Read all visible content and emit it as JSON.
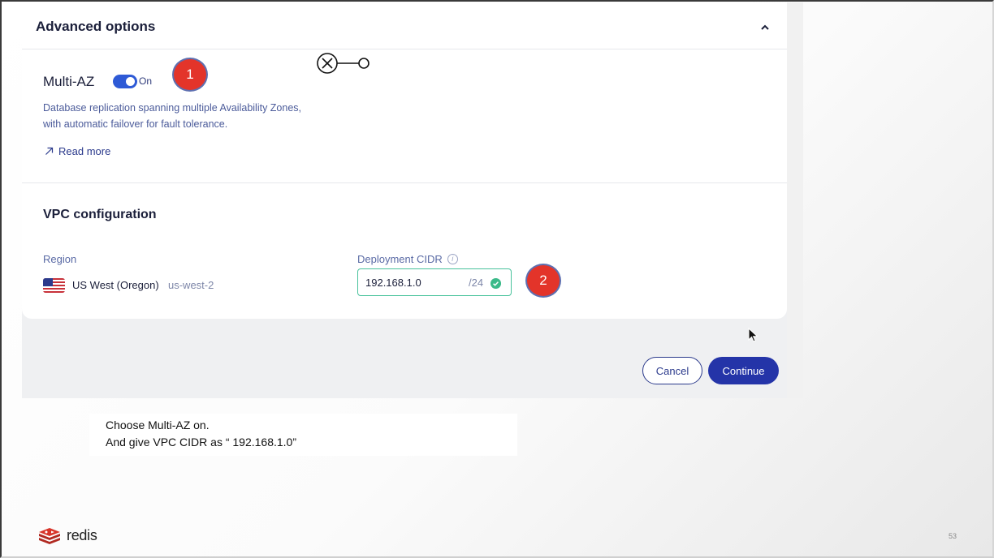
{
  "advanced": {
    "title": "Advanced options",
    "multi_az": {
      "label": "Multi-AZ",
      "toggle_on": true,
      "state_text": "On",
      "description_line1": "Database replication spanning multiple Availability Zones,",
      "description_line2": "with automatic failover for fault tolerance.",
      "read_more": "Read more"
    }
  },
  "vpc": {
    "title": "VPC configuration",
    "region_label": "Region",
    "region_name": "US West (Oregon)",
    "region_code": "us-west-2",
    "cidr_label": "Deployment CIDR",
    "cidr_value": "192.168.1.0",
    "cidr_suffix": "/24"
  },
  "buttons": {
    "cancel": "Cancel",
    "continue": "Continue"
  },
  "annotations": {
    "marker1": "1",
    "marker2": "2"
  },
  "caption": {
    "line1": "Choose  Multi-AZ on.",
    "line2": "And give VPC CIDR as “ 192.168.1.0”"
  },
  "footer": {
    "logo_text": "redis",
    "page_number": "53"
  },
  "colors": {
    "accent": "#2434a8",
    "toggle": "#2e5ad6",
    "success": "#3cba8a",
    "marker": "#e3342a"
  }
}
